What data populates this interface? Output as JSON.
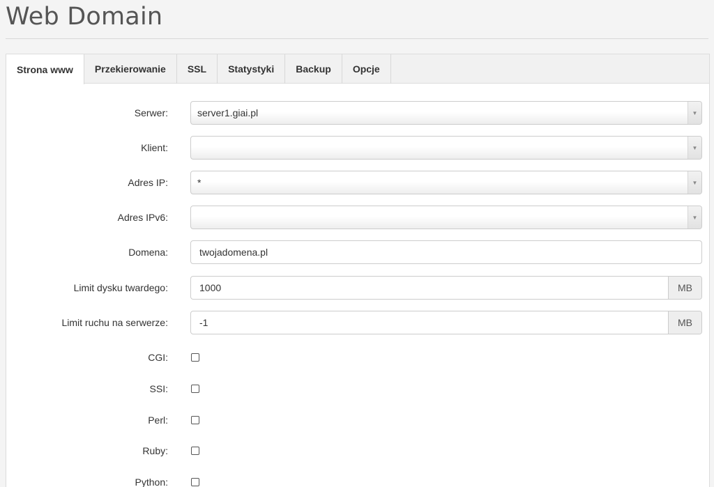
{
  "page": {
    "title": "Web Domain"
  },
  "tabs": [
    {
      "label": "Strona www",
      "active": true
    },
    {
      "label": "Przekierowanie",
      "active": false
    },
    {
      "label": "SSL",
      "active": false
    },
    {
      "label": "Statystyki",
      "active": false
    },
    {
      "label": "Backup",
      "active": false
    },
    {
      "label": "Opcje",
      "active": false
    }
  ],
  "form": {
    "server": {
      "label": "Serwer:",
      "value": "server1.giai.pl"
    },
    "client": {
      "label": "Klient:",
      "value": ""
    },
    "ip": {
      "label": "Adres IP:",
      "value": "*"
    },
    "ipv6": {
      "label": "Adres IPv6:",
      "value": ""
    },
    "domain": {
      "label": "Domena:",
      "value": "twojadomena.pl"
    },
    "hd_quota": {
      "label": "Limit dysku twardego:",
      "value": "1000",
      "unit": "MB"
    },
    "traffic_quota": {
      "label": "Limit ruchu na serwerze:",
      "value": "-1",
      "unit": "MB"
    },
    "cgi": {
      "label": "CGI:",
      "checked": false
    },
    "ssi": {
      "label": "SSI:",
      "checked": false
    },
    "perl": {
      "label": "Perl:",
      "checked": false
    },
    "ruby": {
      "label": "Ruby:",
      "checked": false
    },
    "python": {
      "label": "Python:",
      "checked": false
    }
  },
  "icons": {
    "select_arrow": "chevron-down-icon"
  },
  "colors": {
    "background": "#f4f4f4",
    "panel": "#ffffff",
    "tab_bar": "#f1f1f1",
    "addon": "#eeeeee"
  }
}
